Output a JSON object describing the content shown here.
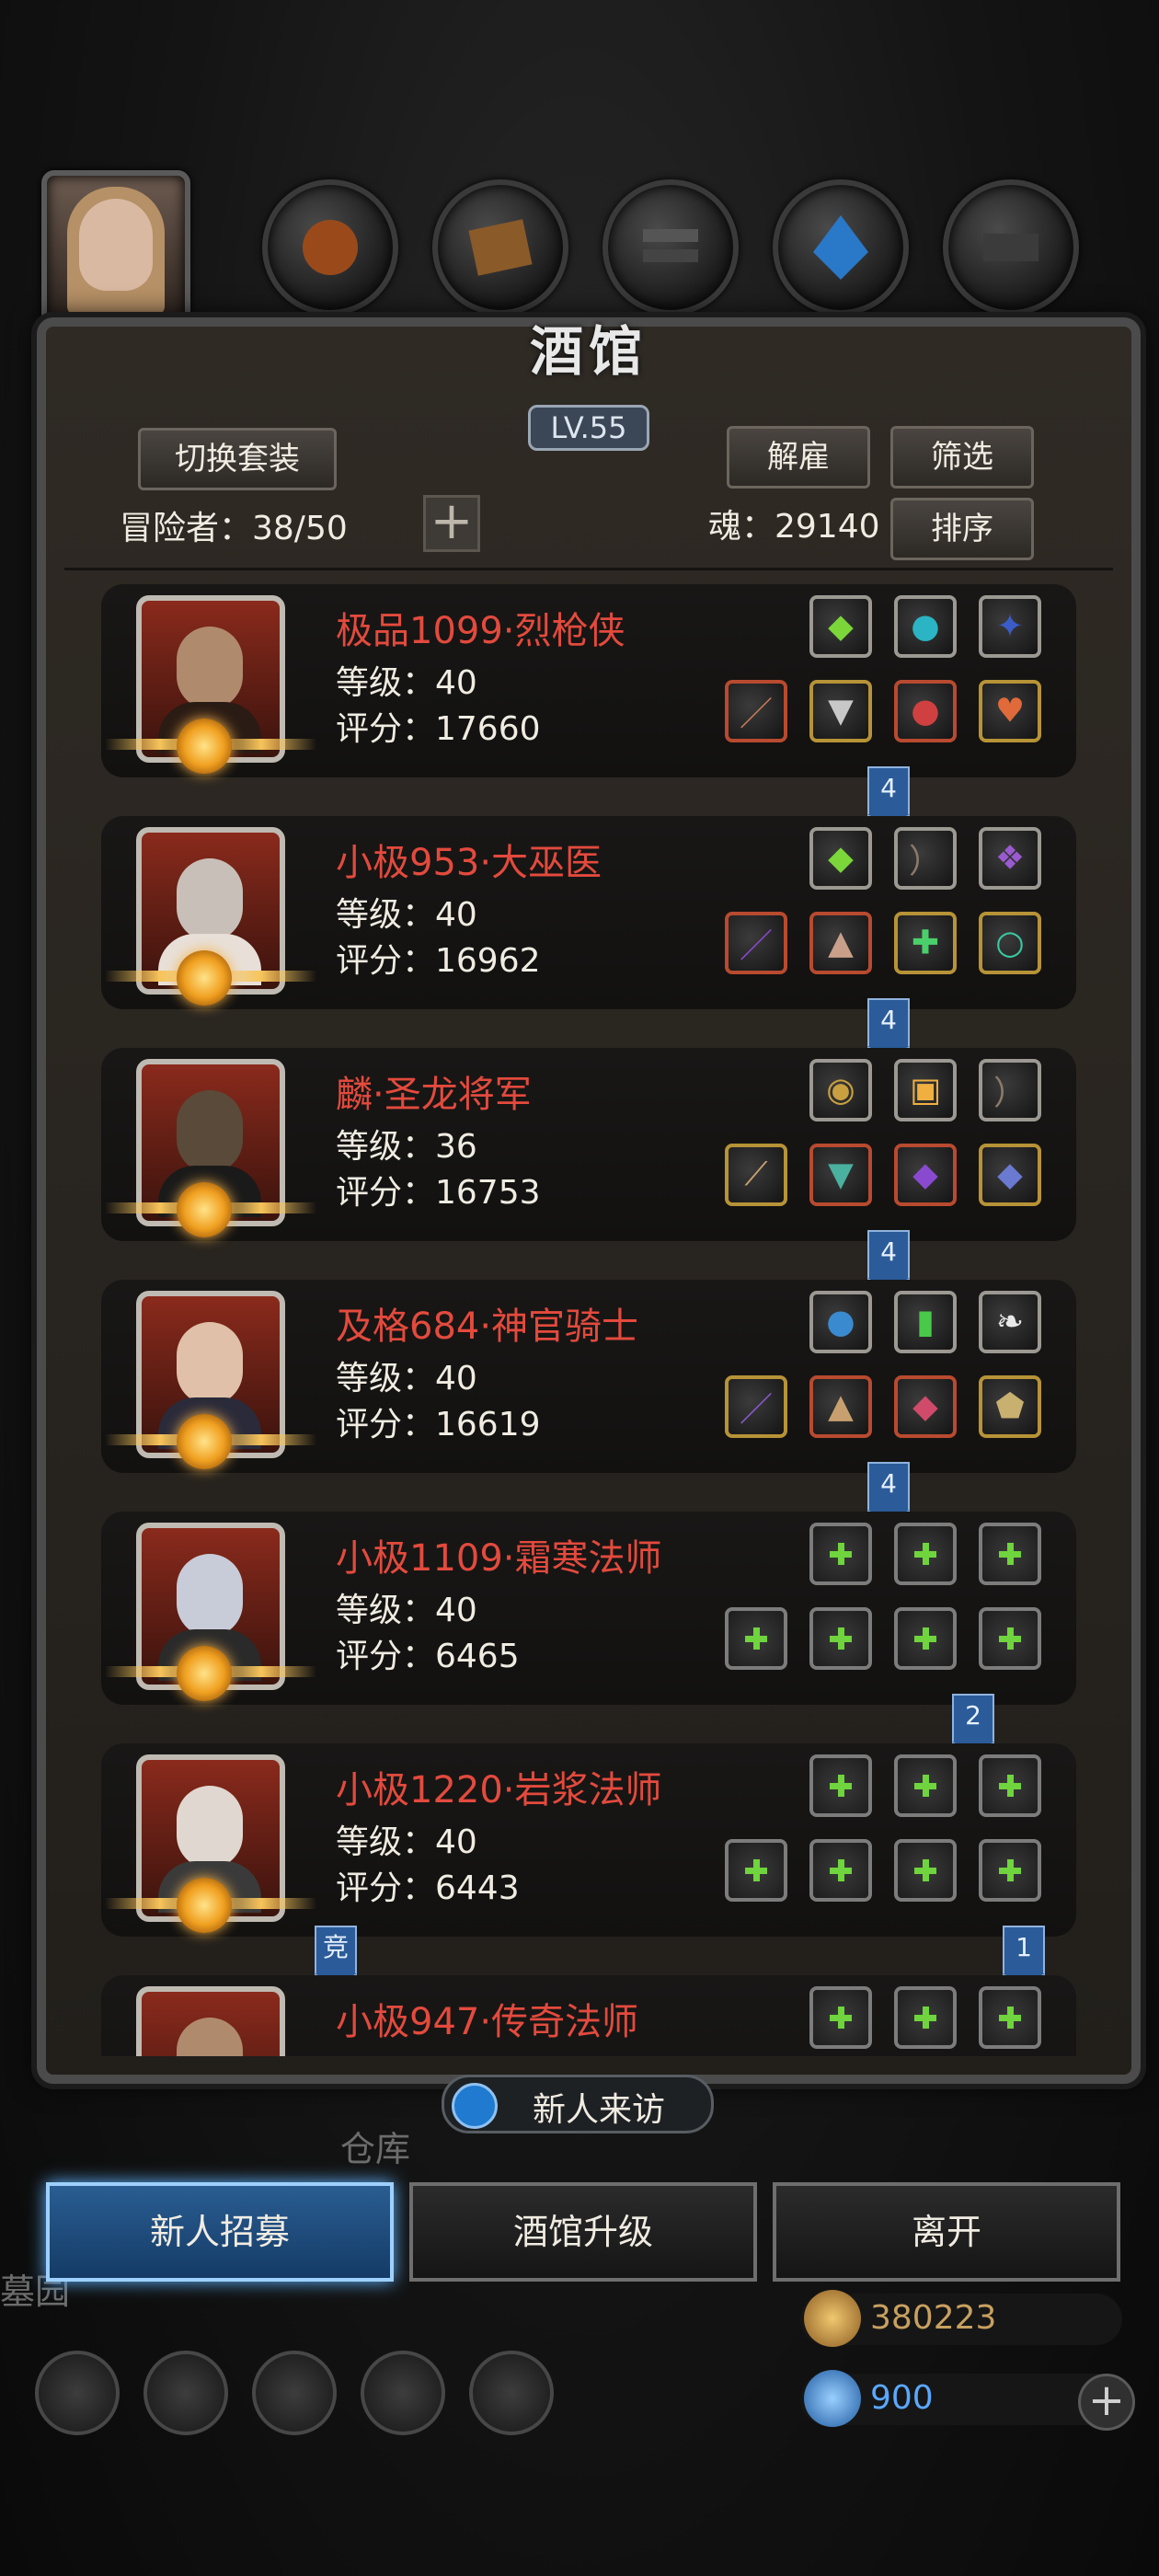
{
  "tavern": {
    "title": "酒馆",
    "level": "LV.55",
    "switch_outfit": "切换套装",
    "dismiss": "解雇",
    "filter": "筛选",
    "sort": "排序",
    "adventurers_label": "冒险者：38/50",
    "soul_label": "魂：29140"
  },
  "heroes": [
    {
      "name": "极品1099·烈枪侠",
      "level": "等级：40",
      "score": "评分：17660",
      "badge": "4"
    },
    {
      "name": "小极953·大巫医",
      "level": "等级：40",
      "score": "评分：16962",
      "badge": "4"
    },
    {
      "name": "麟·圣龙将军",
      "level": "等级：36",
      "score": "评分：16753",
      "badge": "4"
    },
    {
      "name": "及格684·神官骑士",
      "level": "等级：40",
      "score": "评分：16619",
      "badge": "4"
    },
    {
      "name": "小极1109·霜寒法师",
      "level": "等级：40",
      "score": "评分：6465",
      "badge": "2"
    },
    {
      "name": "小极1220·岩浆法师",
      "level": "等级：40",
      "score": "评分：6443",
      "badge": "1",
      "left_badge": "竞"
    },
    {
      "name": "小极947·传奇法师",
      "level": "",
      "score": ""
    }
  ],
  "bottom": {
    "new_visitor": "新人来访",
    "recruit": "新人招募",
    "upgrade": "酒馆升级",
    "leave": "离开"
  },
  "resources": {
    "gold": "380223",
    "gems": "900",
    "colors": {
      "gold": "#c8a060",
      "gems": "#5aa8ff"
    }
  },
  "background": {
    "warehouse": "仓库",
    "garden": "墓园"
  }
}
